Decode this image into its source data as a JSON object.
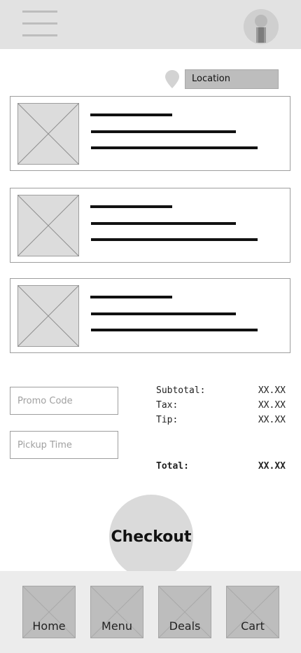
{
  "header": {
    "menu_icon": "hamburger-menu-icon",
    "profile_icon": "user-avatar-icon"
  },
  "location": {
    "label": "Location",
    "icon": "map-pin-icon"
  },
  "cart_items": [
    {
      "thumbnail": "image-placeholder-icon"
    },
    {
      "thumbnail": "image-placeholder-icon"
    },
    {
      "thumbnail": "image-placeholder-icon"
    }
  ],
  "form": {
    "promo_placeholder": "Promo Code",
    "pickup_placeholder": "Pickup Time"
  },
  "summary": {
    "subtotal_label": "Subtotal:",
    "subtotal_value": "XX.XX",
    "tax_label": "Tax:",
    "tax_value": "XX.XX",
    "tip_label": "Tip:",
    "tip_value": "XX.XX",
    "total_label": "Total:",
    "total_value": "XX.XX"
  },
  "checkout_label": "Checkout",
  "nav": {
    "home": "Home",
    "menu": "Menu",
    "deals": "Deals",
    "cart": "Cart"
  },
  "colors": {
    "header_bg": "#e2e2e2",
    "placeholder_fill": "#dcdcdc",
    "nav_bg": "#ececec",
    "button_fill": "#dadada"
  }
}
